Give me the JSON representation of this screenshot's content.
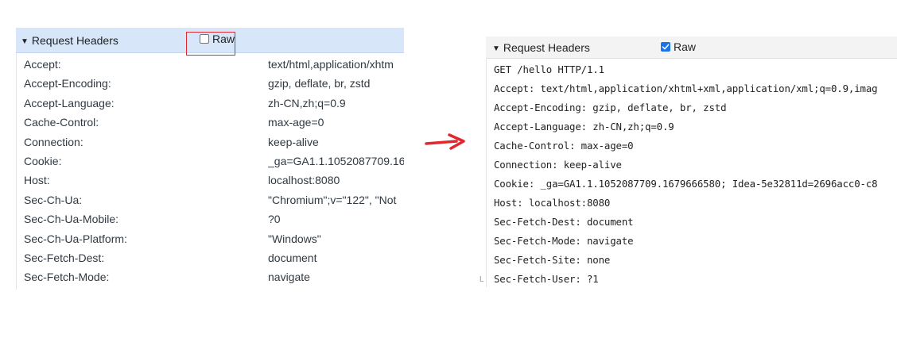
{
  "left": {
    "title": "Request Headers",
    "raw_label": "Raw",
    "raw_checked": false,
    "headers": [
      {
        "name": "Accept:",
        "value": "text/html,application/xhtm"
      },
      {
        "name": "Accept-Encoding:",
        "value": "gzip, deflate, br, zstd"
      },
      {
        "name": "Accept-Language:",
        "value": "zh-CN,zh;q=0.9"
      },
      {
        "name": "Cache-Control:",
        "value": "max-age=0"
      },
      {
        "name": "Connection:",
        "value": "keep-alive"
      },
      {
        "name": "Cookie:",
        "value": "_ga=GA1.1.1052087709.16"
      },
      {
        "name": "Host:",
        "value": "localhost:8080"
      },
      {
        "name": "Sec-Ch-Ua:",
        "value": "\"Chromium\";v=\"122\", \"Not"
      },
      {
        "name": "Sec-Ch-Ua-Mobile:",
        "value": "?0"
      },
      {
        "name": "Sec-Ch-Ua-Platform:",
        "value": "\"Windows\""
      },
      {
        "name": "Sec-Fetch-Dest:",
        "value": "document"
      },
      {
        "name": "Sec-Fetch-Mode:",
        "value": "navigate"
      }
    ],
    "edge_glyph": "¤L"
  },
  "right": {
    "title": "Request Headers",
    "raw_label": "Raw",
    "raw_checked": true,
    "lines": [
      "GET /hello HTTP/1.1",
      "Accept: text/html,application/xhtml+xml,application/xml;q=0.9,imag",
      "Accept-Encoding: gzip, deflate, br, zstd",
      "Accept-Language: zh-CN,zh;q=0.9",
      "Cache-Control: max-age=0",
      "Connection: keep-alive",
      "Cookie: _ga=GA1.1.1052087709.1679666580; Idea-5e32811d=2696acc0-c8",
      "Host: localhost:8080",
      "Sec-Fetch-Dest: document",
      "Sec-Fetch-Mode: navigate",
      "Sec-Fetch-Site: none",
      "Sec-Fetch-User: ?1"
    ],
    "edge_glyph": "L"
  },
  "colors": {
    "header_bg_left": "#d7e6f9",
    "header_bg_right": "#f3f3f3",
    "highlight": "#e0282e",
    "arrow": "#e0282e",
    "checkbox_checked": "#1a73e8"
  },
  "icons": {
    "toggle": "triangle-down-icon",
    "transition": "right-arrow-icon"
  }
}
